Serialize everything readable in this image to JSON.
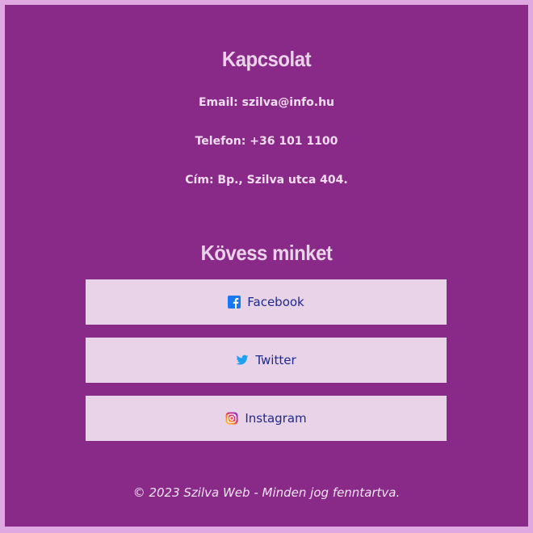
{
  "contact": {
    "heading": "Kapcsolat",
    "email": "Email: szilva@info.hu",
    "phone": "Telefon: +36 101 1100",
    "address": "Cím: Bp., Szilva utca 404."
  },
  "follow": {
    "heading": "Kövess minket",
    "buttons": [
      {
        "label": "Facebook",
        "icon": "facebook-icon"
      },
      {
        "label": "Twitter",
        "icon": "twitter-icon"
      },
      {
        "label": "Instagram",
        "icon": "instagram-icon"
      }
    ]
  },
  "footer": {
    "text": "© 2023 Szilva Web - Minden jog fenntartva."
  },
  "colors": {
    "page_border": "#e0a8e0",
    "background": "#8a2a88",
    "button_bg": "#e8d3e8",
    "button_text": "#1f2a8a",
    "facebook": "#1877f2",
    "twitter": "#1da1f2"
  }
}
